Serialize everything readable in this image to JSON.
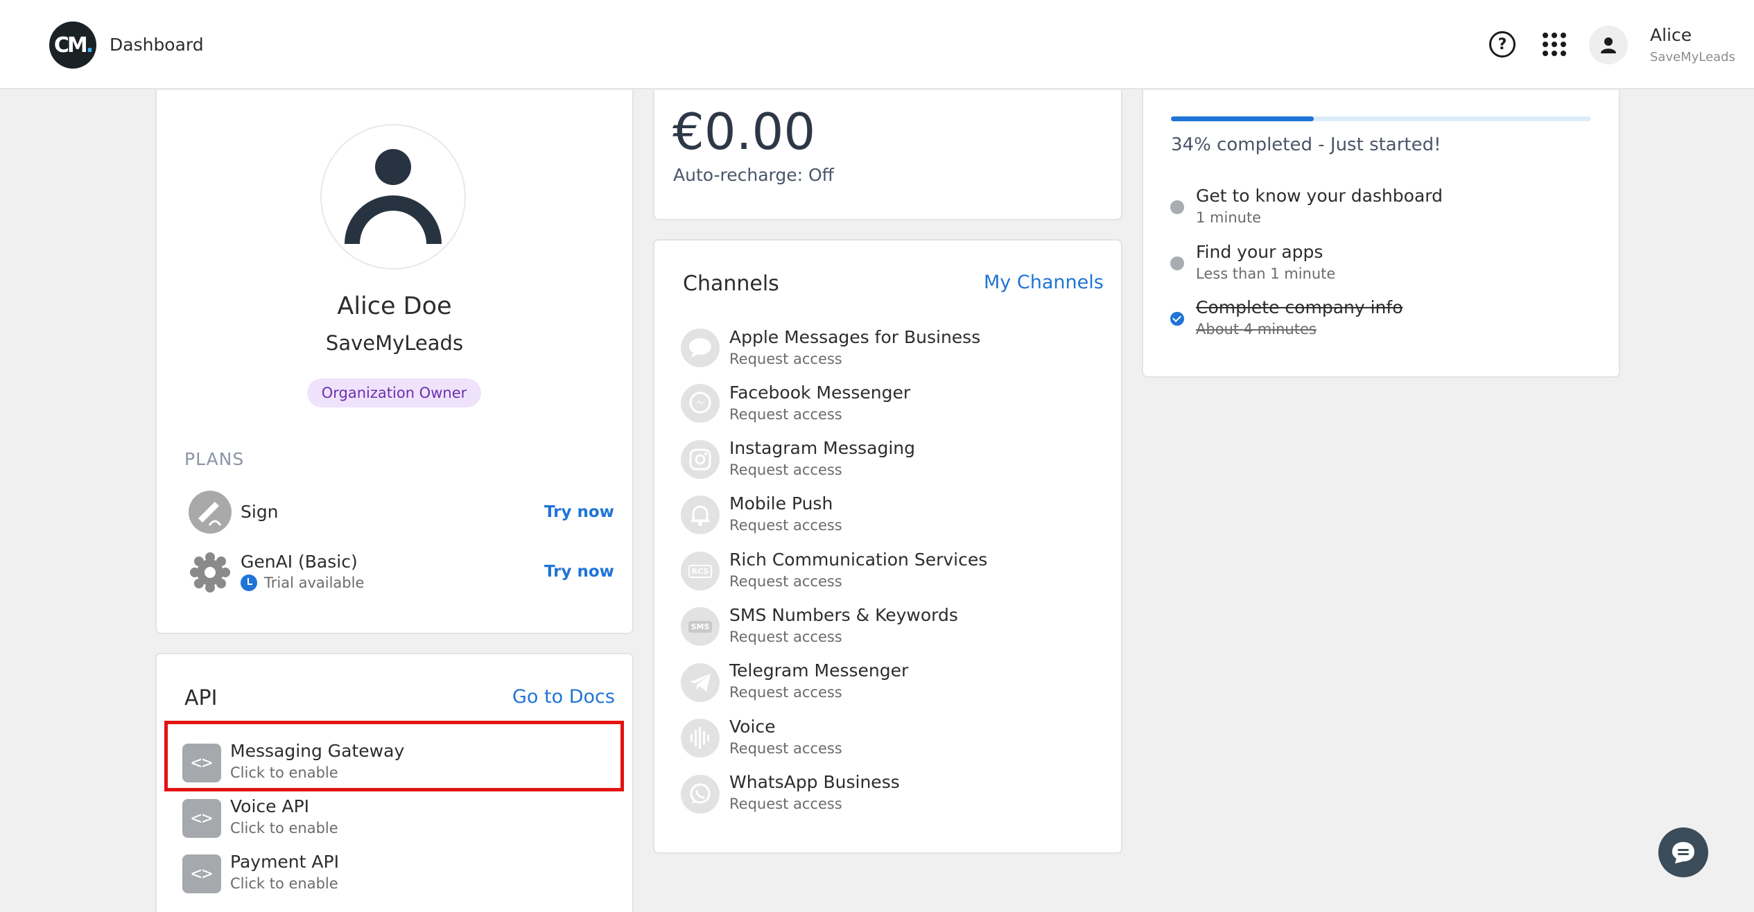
{
  "header": {
    "logo_text": "CM",
    "logo_dot": ".",
    "title": "Dashboard",
    "help_glyph": "?",
    "user_name": "Alice",
    "user_org": "SaveMyLeads"
  },
  "profile": {
    "name": "Alice Doe",
    "org": "SaveMyLeads",
    "role": "Organization Owner"
  },
  "plans": {
    "label": "PLANS",
    "items": [
      {
        "title": "Sign",
        "sub": "",
        "action": "Try now",
        "icon": "sign-icon"
      },
      {
        "title": "GenAI (Basic)",
        "sub": "Trial available",
        "action": "Try now",
        "icon": "genai-icon"
      }
    ]
  },
  "api": {
    "title": "API",
    "docs_link": "Go to Docs",
    "items": [
      {
        "title": "Messaging Gateway",
        "sub": "Click to enable",
        "icon_glyph": "<>"
      },
      {
        "title": "Voice API",
        "sub": "Click to enable",
        "icon_glyph": "<>"
      },
      {
        "title": "Payment API",
        "sub": "Click to enable",
        "icon_glyph": "<>"
      }
    ]
  },
  "balance": {
    "amount": "€0.00",
    "auto_recharge": "Auto-recharge: Off"
  },
  "channels": {
    "title": "Channels",
    "link": "My Channels",
    "items": [
      {
        "title": "Apple Messages for Business",
        "sub": "Request access",
        "icon": "apple-messages-icon"
      },
      {
        "title": "Facebook Messenger",
        "sub": "Request access",
        "icon": "messenger-icon"
      },
      {
        "title": "Instagram Messaging",
        "sub": "Request access",
        "icon": "instagram-icon"
      },
      {
        "title": "Mobile Push",
        "sub": "Request access",
        "icon": "bell-icon"
      },
      {
        "title": "Rich Communication Services",
        "sub": "Request access",
        "icon": "rcs-icon",
        "icon_text": "RCS"
      },
      {
        "title": "SMS Numbers & Keywords",
        "sub": "Request access",
        "icon": "sms-icon",
        "icon_text": "SMS"
      },
      {
        "title": "Telegram Messenger",
        "sub": "Request access",
        "icon": "telegram-icon"
      },
      {
        "title": "Voice",
        "sub": "Request access",
        "icon": "voice-wave-icon"
      },
      {
        "title": "WhatsApp Business",
        "sub": "Request access",
        "icon": "whatsapp-icon"
      }
    ]
  },
  "onboarding": {
    "progress": 0.34,
    "progress_text": "34% completed - Just started!",
    "steps": [
      {
        "title": "Get to know your dashboard",
        "sub": "1 minute",
        "done": false
      },
      {
        "title": "Find your apps",
        "sub": "Less than 1 minute",
        "done": false
      },
      {
        "title": "Complete company info",
        "sub": "About 4 minutes",
        "done": true
      }
    ]
  },
  "colors": {
    "accent": "#1f74d6",
    "highlight": "#e31313",
    "role_badge_bg": "#efe3fb",
    "role_badge_text": "#6d2fb0"
  }
}
